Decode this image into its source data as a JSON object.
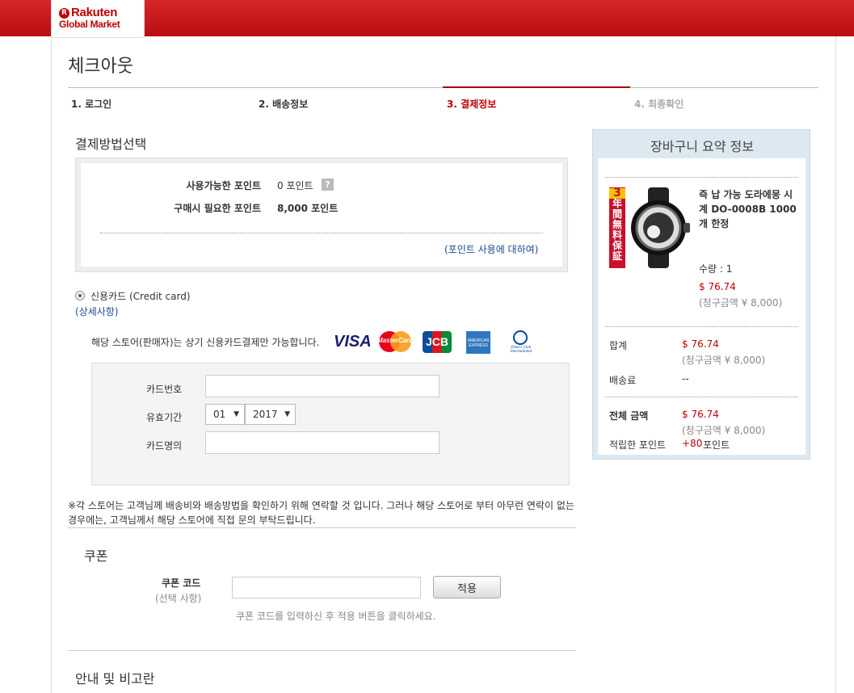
{
  "brand": {
    "line1": "Rakuten",
    "line2": "Global Market",
    "mark": "R"
  },
  "page_title": "체크아웃",
  "steps": [
    "1. 로그인",
    "2. 배송정보",
    "3. 결제정보",
    "4. 최종확인"
  ],
  "payment": {
    "heading": "결제방법선택",
    "available_points_label": "사용가능한 포인트",
    "available_points_value": "0 포인트",
    "help_icon": "?",
    "required_points_label": "구매시 필요한 포인트",
    "required_points_value": "8,000 포인트",
    "points_link": "(포인트 사용에 대하여)",
    "credit_card_label": "신용카드 (Credit card)",
    "details_link": "(상세사항)",
    "card_notice": "해당 스토어(판매자)는 상기 신용카드결제만 가능합니다.",
    "card_logos": [
      "VISA",
      "MasterCard",
      "JCB",
      "AMERICAN EXPRESS",
      "Diners Club International"
    ],
    "card_number_label": "카드번호",
    "card_number_value": "",
    "expiry_label": "유효기간",
    "expiry_month": "01",
    "expiry_year": "2017",
    "card_name_label": "카드명의",
    "card_name_value": "",
    "notice": "※각 스토어는 고객님께 배송비와 배송방법을 확인하기 위해 연락할 것 입니다. 그러나 해당 스토어로 부터 아무런 연락이 없는 경우에는, 고객님께서 해당 스토어에 직접 문의 부탁드립니다."
  },
  "coupon": {
    "heading": "쿠폰",
    "code_label": "쿠폰 코드",
    "optional": "(선택 사항)",
    "code_value": "",
    "apply_button": "적용",
    "hint": "쿠폰 코드를 입력하신 후 적용 버튼을 클릭하세요."
  },
  "info_heading": "안내 및 비고란",
  "summary": {
    "title": "장바구니 요약 정보",
    "badge": [
      "3",
      "年",
      "間",
      "無",
      "料",
      "保",
      "証"
    ],
    "product_name": "즉 납 가능 도라에몽 시계 DO-0008B 1000개 한정",
    "qty": "수량 : 1",
    "price": "$ 76.74",
    "price_krw": "(청구금액 ¥ 8,000)",
    "subtotal_label": "합계",
    "subtotal": "$ 76.74",
    "subtotal_krw": "(청구금액 ¥ 8,000)",
    "shipping_label": "배송료",
    "shipping": "--",
    "total_label": "전체 금액",
    "total": "$ 76.74",
    "total_krw": "(청구금액 ¥ 8,000)",
    "earn_label": "적립한 포인트",
    "earn_value": "+80",
    "earn_unit": "포인트"
  },
  "colors": {
    "brand_red": "#bf0000",
    "link_blue": "#1a4b8c",
    "summary_bg": "#dde9f1"
  }
}
